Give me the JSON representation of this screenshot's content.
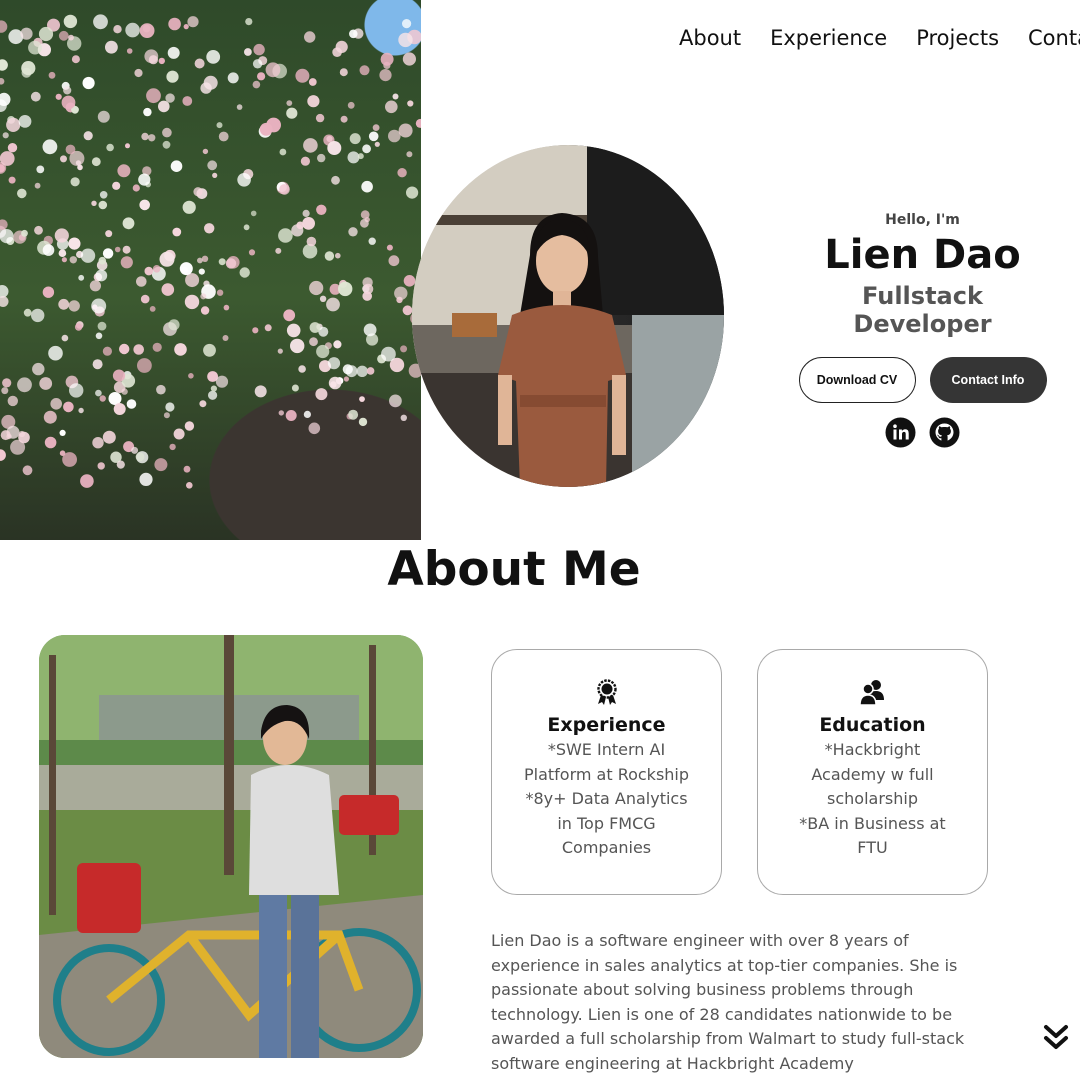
{
  "nav": {
    "items": [
      "About",
      "Experience",
      "Projects",
      "Contact"
    ]
  },
  "hero": {
    "greeting": "Hello, I'm",
    "name": "Lien Dao",
    "role": "Fullstack Developer",
    "download_label": "Download CV",
    "contact_label": "Contact Info",
    "social_icons": [
      "linkedin-icon",
      "github-icon"
    ]
  },
  "about": {
    "title": "About Me",
    "cards": [
      {
        "icon": "award-icon",
        "title": "Experience",
        "lines": [
          "*SWE Intern AI",
          "Platform at Rockship",
          "*8y+ Data Analytics",
          "in Top FMCG",
          "Companies"
        ]
      },
      {
        "icon": "users-icon",
        "title": "Education",
        "lines": [
          "*Hackbright",
          "Academy w full",
          "scholarship",
          "*BA in Business at",
          "FTU"
        ]
      }
    ],
    "description": "Lien Dao is a software engineer with over 8 years of experience in sales analytics at top-tier companies. She is passionate about solving business problems through technology. Lien is one of 28 candidates nationwide to be awarded a full scholarship from Walmart to study full-stack software engineering at Hackbright Academy",
    "scroll_icon": "double-chevron-down-icon"
  },
  "colors": {
    "text_primary": "#111111",
    "text_secondary": "#555555",
    "button_dark": "#353535",
    "card_border": "#a9a9a9"
  }
}
